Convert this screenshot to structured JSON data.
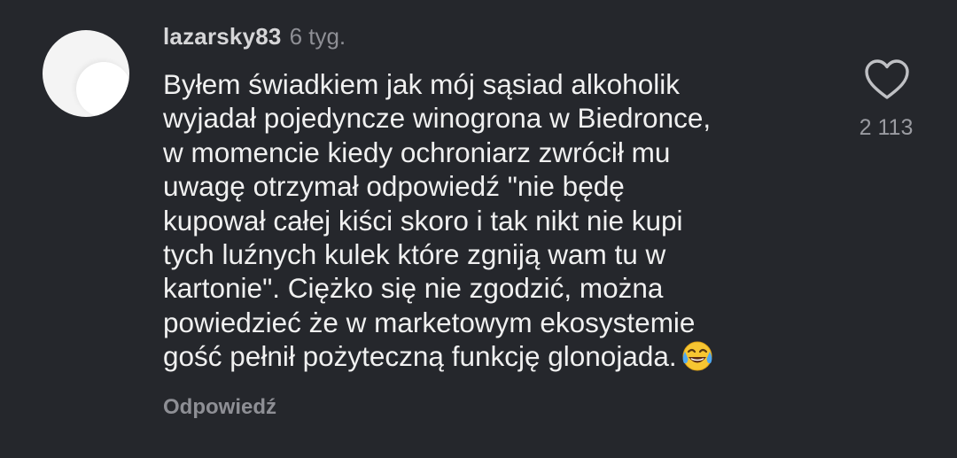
{
  "comment": {
    "username": "lazarsky83",
    "time_ago": "6 tyg.",
    "lines": [
      "Byłem świadkiem jak mój sąsiad alkoholik",
      "wyjadał pojedyncze winogrona w Biedronce,",
      "w momencie kiedy ochroniarz zwrócił mu",
      "uwagę otrzymał odpowiedź \"nie będę",
      "kupował całej kiści skoro i tak nikt nie kupi",
      "tych luźnych kulek które zgniją wam tu w",
      "kartonie\". Ciężko się nie zgodzić, można",
      "powiedzieć że w marketowym ekosystemie",
      "gość pełnił pożyteczną funkcję glonojada."
    ],
    "emoji": "face-with-tears-of-joy",
    "reply_label": "Odpowiedź",
    "like_count": "2 113",
    "like_icon": "heart-outline-icon"
  },
  "colors": {
    "background": "#25272c",
    "text": "#f0f0f0",
    "muted": "#8e8f95",
    "username": "#d6d6d8"
  }
}
